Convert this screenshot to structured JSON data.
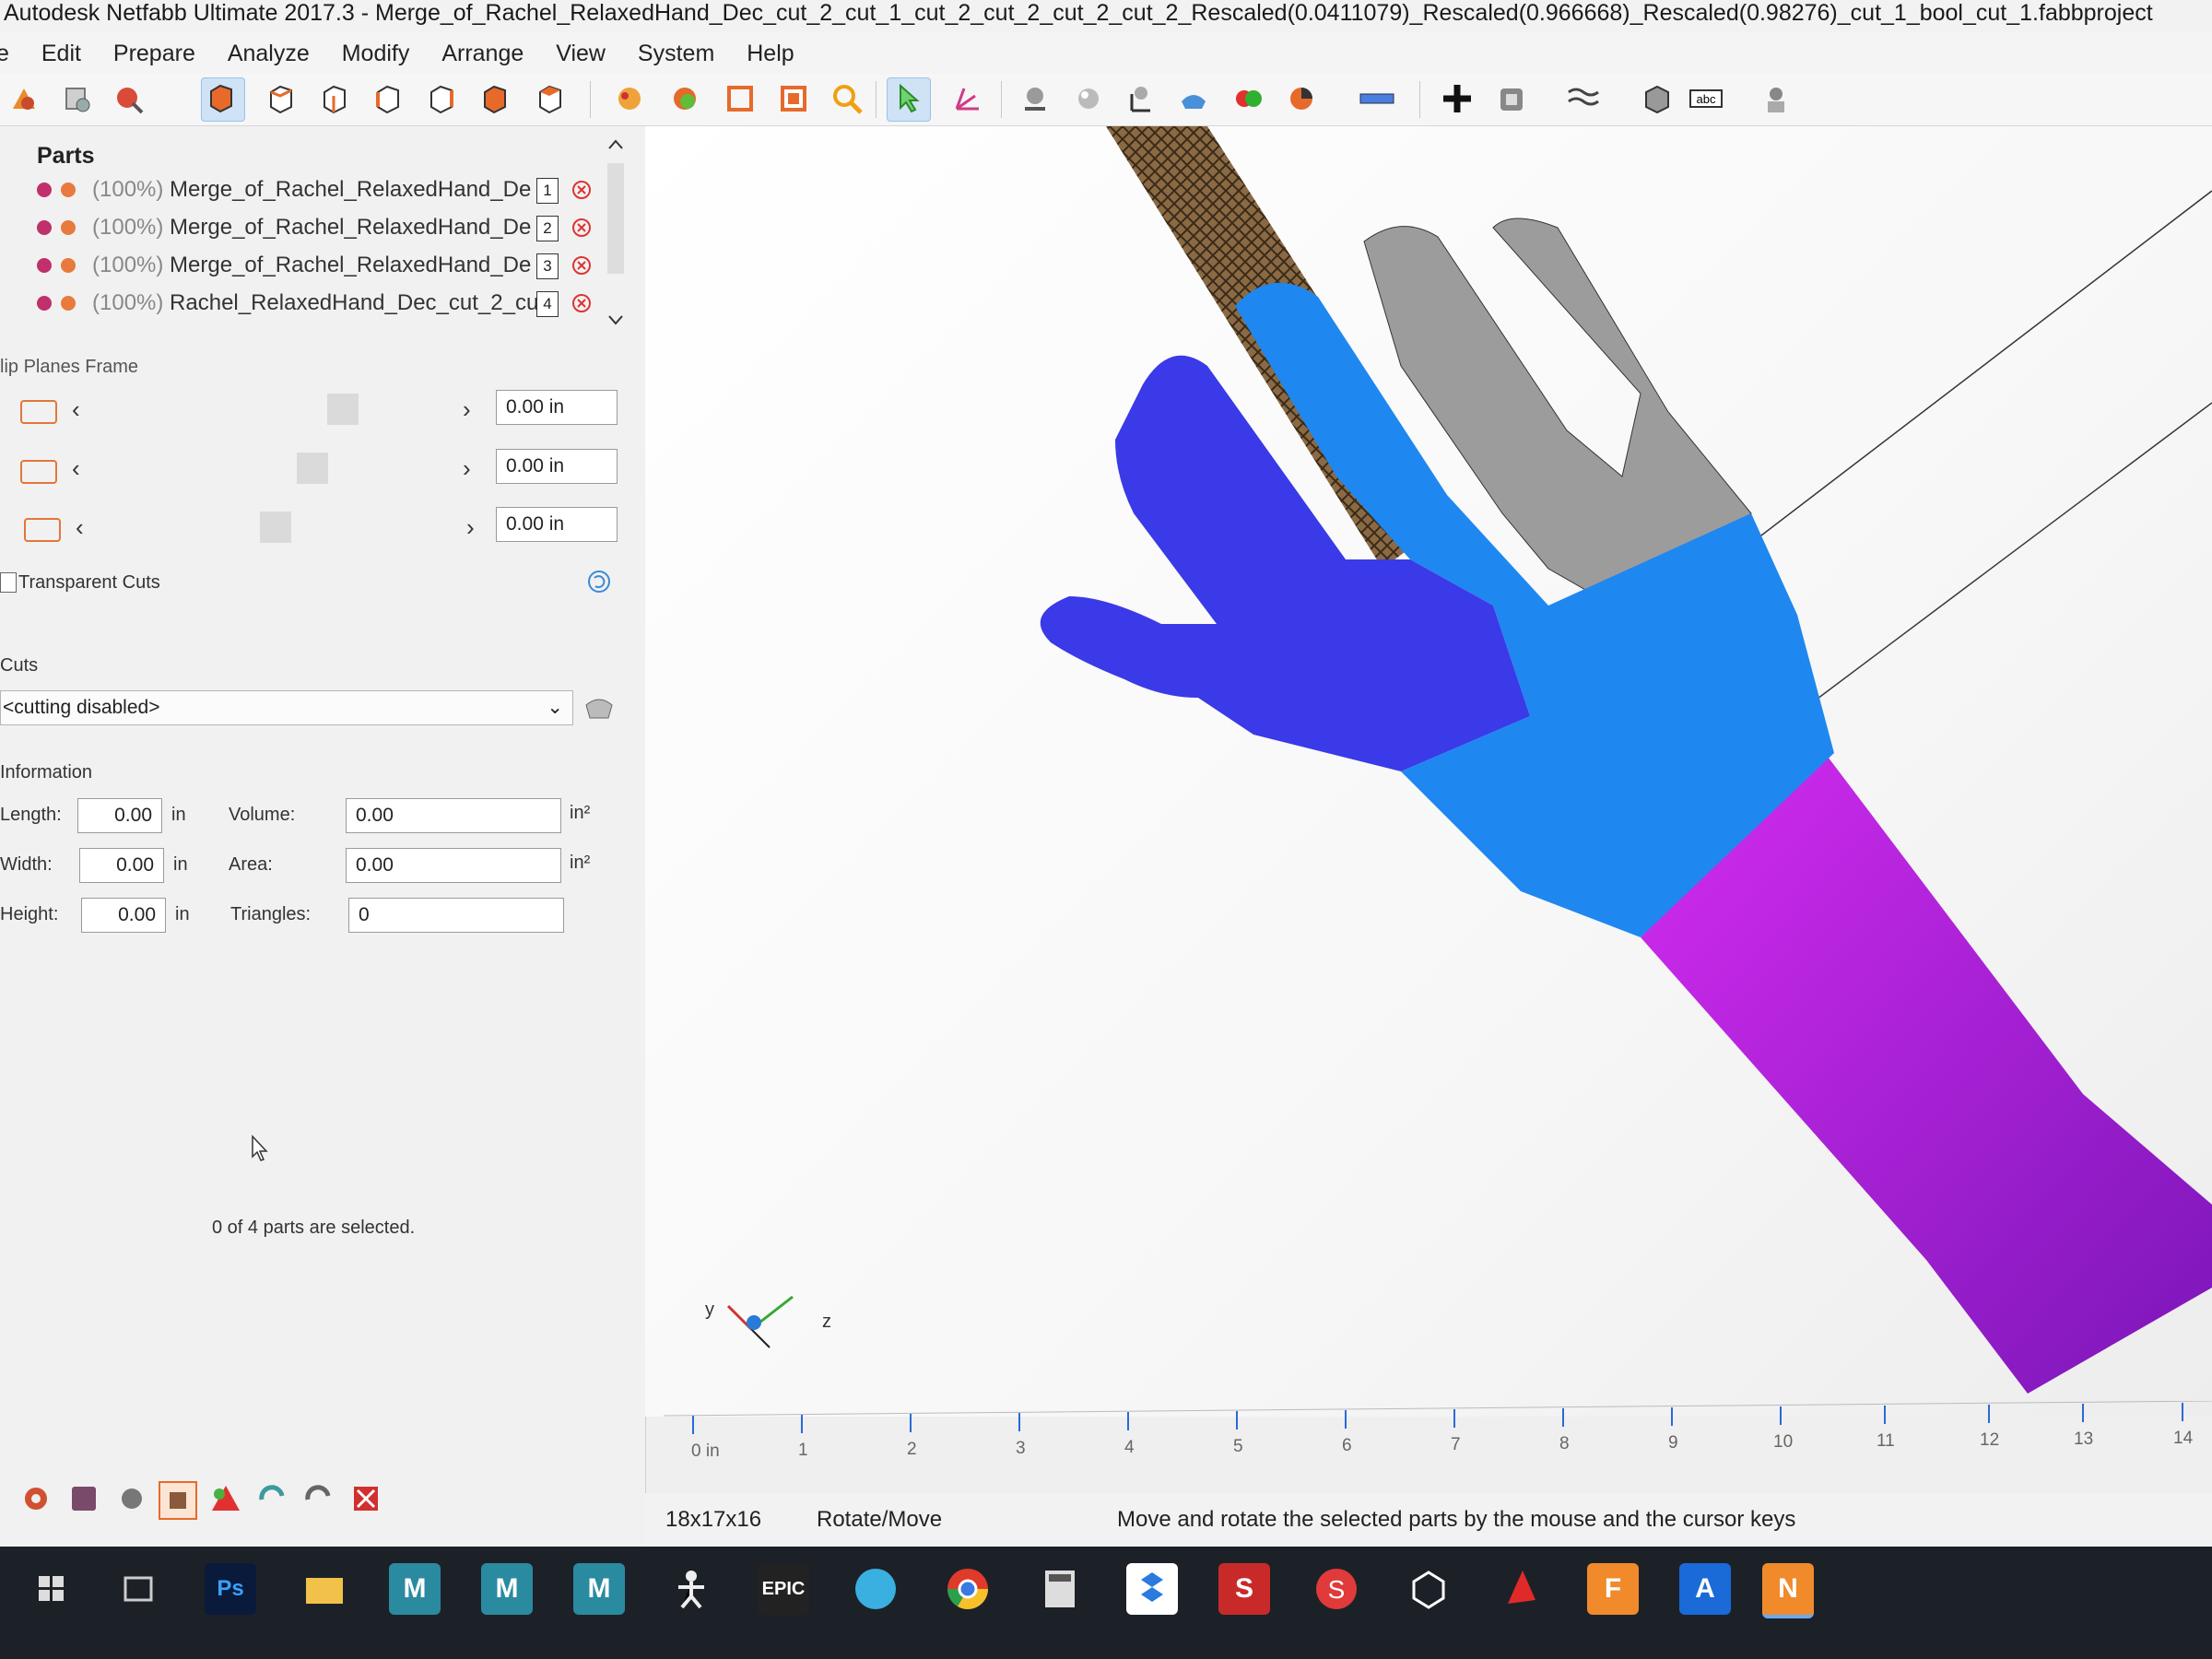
{
  "window": {
    "title": "Autodesk Netfabb Ultimate 2017.3 - Merge_of_Rachel_RelaxedHand_Dec_cut_2_cut_1_cut_2_cut_2_cut_2_cut_2_Rescaled(0.0411079)_Rescaled(0.966668)_Rescaled(0.98276)_cut_1_bool_cut_1.fabbproject"
  },
  "menu": [
    "e",
    "Edit",
    "Prepare",
    "Analyze",
    "Modify",
    "Arrange",
    "View",
    "System",
    "Help"
  ],
  "toolbar": {
    "icons": [
      "new-project-icon",
      "parts-icon",
      "repair-icon",
      "add-part-icon",
      "view-default-icon",
      "view-front-icon",
      "view-back-icon",
      "view-left-icon",
      "view-right-icon",
      "view-top-icon",
      "view-bottom-icon",
      "color-icon",
      "texture-icon",
      "wireframe-icon",
      "section-icon",
      "zoom-icon",
      "select-icon",
      "move-icon",
      "sphere-icon",
      "shade-icon",
      "support-icon",
      "slice-icon",
      "boolean-icon",
      "pie-icon",
      "ruler-icon",
      "add-icon",
      "shell-icon",
      "wave-icon",
      "cube-icon",
      "label-icon",
      "pawn-icon"
    ]
  },
  "parts": {
    "title": "Parts",
    "items": [
      {
        "percent": "(100%)",
        "name": "Merge_of_Rachel_RelaxedHand_De",
        "index": "1"
      },
      {
        "percent": "(100%)",
        "name": "Merge_of_Rachel_RelaxedHand_De",
        "index": "2"
      },
      {
        "percent": "(100%)",
        "name": "Merge_of_Rachel_RelaxedHand_De",
        "index": "3"
      },
      {
        "percent": "(100%)",
        "name": "Rachel_RelaxedHand_Dec_cut_2_cu",
        "index": "4"
      }
    ]
  },
  "clip_planes": {
    "title": "lip Planes Frame",
    "values": [
      "0.00 in",
      "0.00 in",
      "0.00 in"
    ],
    "transparent_cuts": "Transparent Cuts"
  },
  "cuts": {
    "title": "Cuts",
    "selected": "<cutting disabled>"
  },
  "information": {
    "title": "Information",
    "length_label": "Length:",
    "length": "0.00",
    "width_label": "Width:",
    "width": "0.00",
    "height_label": "Height:",
    "height": "0.00",
    "unit": "in",
    "volume_label": "Volume:",
    "volume": "0.00",
    "area_label": "Area:",
    "area": "0.00",
    "triangles_label": "Triangles:",
    "triangles": "0",
    "unit_sq": "in²"
  },
  "selection_status": "0 of 4 parts are selected.",
  "axes": {
    "y": "y",
    "z": "z"
  },
  "ruler": [
    "0 in",
    "1",
    "2",
    "3",
    "4",
    "5",
    "6",
    "7",
    "8",
    "9",
    "10",
    "11",
    "12",
    "13",
    "14"
  ],
  "statusbar": {
    "dims": "18x17x16",
    "mode": "Rotate/Move",
    "message": "Move and rotate the selected parts by the mouse and the cursor keys"
  },
  "taskbar": [
    "windows-start-icon",
    "task-view-icon",
    "photoshop-icon",
    "file-explorer-icon",
    "maya-icon",
    "maya-icon-2",
    "maya-icon-3",
    "motionbuilder-icon",
    "epic-launcher-icon",
    "sketchbook-icon",
    "chrome-icon",
    "calculator-icon",
    "dropbox-icon",
    "substance-icon",
    "substance-icon-2",
    "unity-icon",
    "autodesk-icon",
    "fusion-icon",
    "autocad-icon",
    "netfabb-icon"
  ],
  "colors": {
    "finger_blue": "#3a3ae8",
    "palm_blue": "#1f87f0",
    "gray_fingers": "#9c9c9c",
    "forearm": "#b722e0",
    "accent": "#e2763c"
  }
}
